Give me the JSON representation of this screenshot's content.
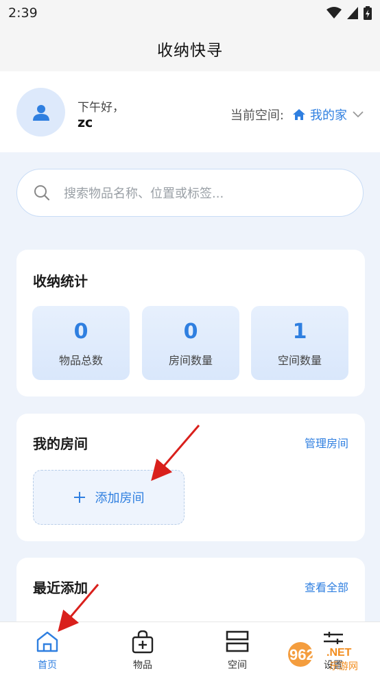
{
  "status": {
    "time": "2:39"
  },
  "app": {
    "title": "收纳快寻"
  },
  "header": {
    "greeting": "下午好，",
    "username": "zc",
    "space_label": "当前空间:",
    "space_value": "我的家"
  },
  "search": {
    "placeholder": "搜索物品名称、位置或标签..."
  },
  "stats": {
    "title": "收纳统计",
    "items": [
      {
        "value": "0",
        "label": "物品总数"
      },
      {
        "value": "0",
        "label": "房间数量"
      },
      {
        "value": "1",
        "label": "空间数量"
      }
    ]
  },
  "rooms": {
    "title": "我的房间",
    "manage_label": "管理房间",
    "add_label": "添加房间"
  },
  "recent": {
    "title": "最近添加",
    "view_all_label": "查看全部"
  },
  "tabs": [
    {
      "label": "首页",
      "icon": "home-icon",
      "active": true
    },
    {
      "label": "物品",
      "icon": "bag-plus-icon",
      "active": false
    },
    {
      "label": "空间",
      "icon": "layers-icon",
      "active": false
    },
    {
      "label": "设置",
      "icon": "sliders-icon",
      "active": false
    }
  ],
  "watermark": {
    "text": "962.NET",
    "subtext": "乐游网"
  },
  "colors": {
    "accent": "#2f7fe0",
    "annotation": "#d9201c",
    "background": "#eef3fb"
  }
}
